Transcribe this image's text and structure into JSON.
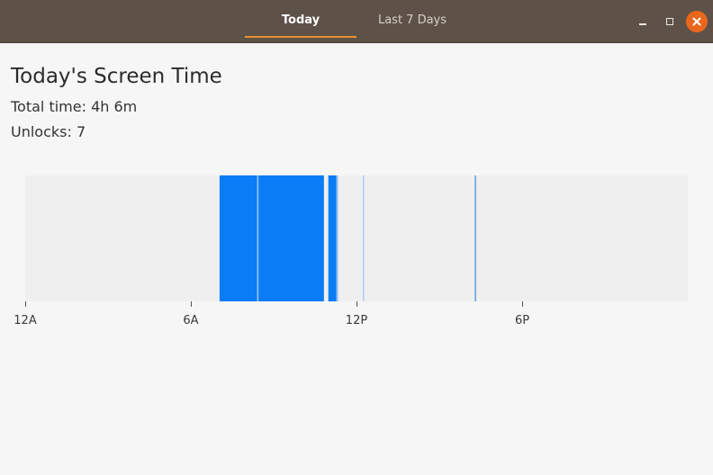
{
  "tabs": [
    {
      "label": "Today",
      "active": true
    },
    {
      "label": "Last 7 Days",
      "active": false
    }
  ],
  "window_controls": {
    "minimize_icon": "minimize-icon",
    "maximize_icon": "maximize-icon",
    "close_icon": "close-icon",
    "close_color": "#e9671d"
  },
  "summary": {
    "title": "Today's Screen Time",
    "total_time": "Total time: 4h 6m",
    "unlocks": "Unlocks: 7"
  },
  "chart_data": {
    "type": "bar",
    "xlim_hours": [
      0,
      24
    ],
    "ticks": [
      {
        "label": "12A",
        "hour": 0
      },
      {
        "label": "6A",
        "hour": 6
      },
      {
        "label": "12P",
        "hour": 12
      },
      {
        "label": "6P",
        "hour": 18
      }
    ],
    "sessions": [
      {
        "start": 7.04,
        "end": 8.4,
        "style": "active"
      },
      {
        "start": 8.4,
        "end": 8.45,
        "style": "light"
      },
      {
        "start": 8.45,
        "end": 10.82,
        "style": "active"
      },
      {
        "start": 10.98,
        "end": 11.27,
        "style": "active"
      },
      {
        "start": 11.27,
        "end": 11.33,
        "style": "light"
      },
      {
        "start": 12.24,
        "end": 12.27,
        "style": "light"
      },
      {
        "start": 16.29,
        "end": 16.32,
        "style": "thin"
      }
    ],
    "colors": {
      "background": "#efefef",
      "active": "#0a7cf5",
      "light": "#8ebff5",
      "thin": "#1671d6"
    }
  }
}
